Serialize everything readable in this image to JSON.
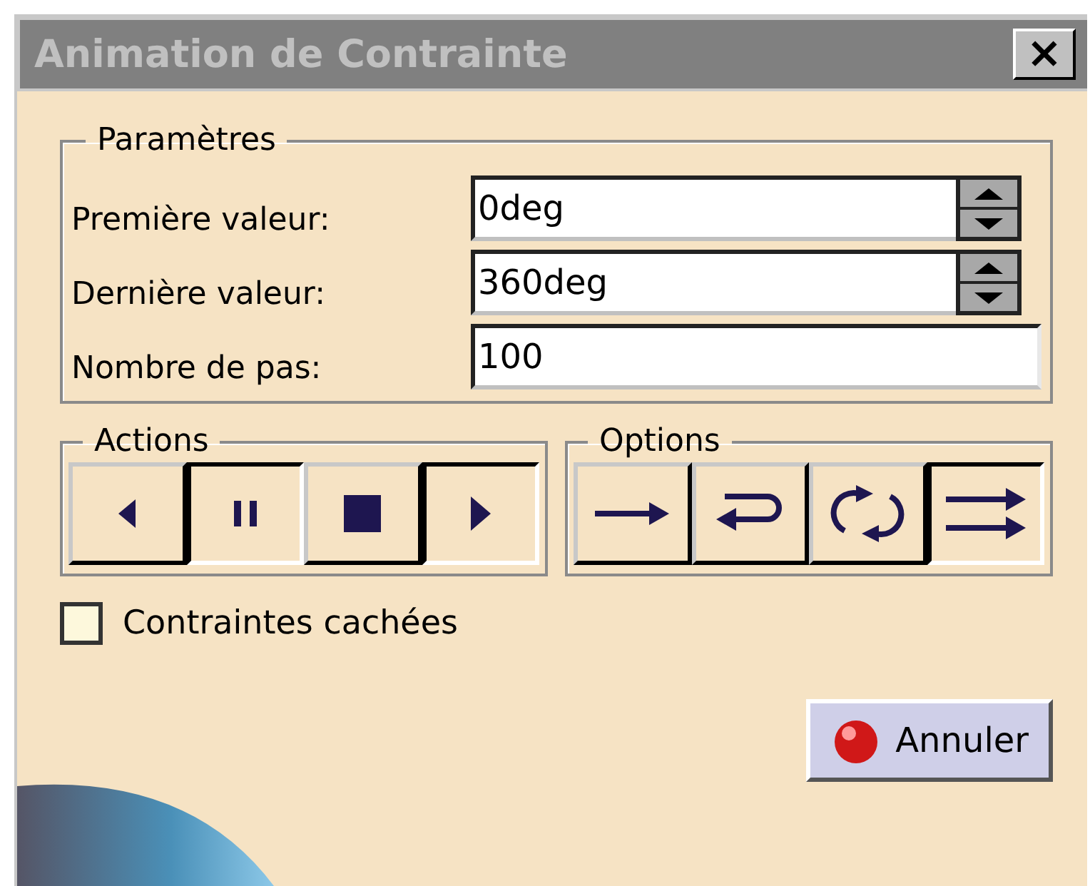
{
  "window": {
    "title": "Animation de Contrainte",
    "close": "×"
  },
  "parameters": {
    "title": "Paramètres",
    "fields": [
      {
        "kind": "spin",
        "label": "Première valeur:",
        "value": "0deg"
      },
      {
        "kind": "spin",
        "label": "Dernière valeur:",
        "value": "360deg"
      },
      {
        "kind": "text",
        "label": "Nombre de pas:",
        "value": "100"
      }
    ]
  },
  "actions": {
    "title": "Actions",
    "buttons": [
      {
        "kind": "back",
        "selected": false
      },
      {
        "kind": "pause",
        "selected": true
      },
      {
        "kind": "stop",
        "selected": false
      },
      {
        "kind": "play",
        "selected": true
      }
    ]
  },
  "options": {
    "title": "Options",
    "buttons": [
      {
        "kind": "once",
        "selected": false
      },
      {
        "kind": "loop",
        "selected": false
      },
      {
        "kind": "repeat",
        "selected": false
      },
      {
        "kind": "reverse",
        "selected": true
      }
    ]
  },
  "hidden_constraints": {
    "label": "Contraintes cachées",
    "checked": false
  },
  "cancel_button": {
    "label": "Annuler"
  }
}
